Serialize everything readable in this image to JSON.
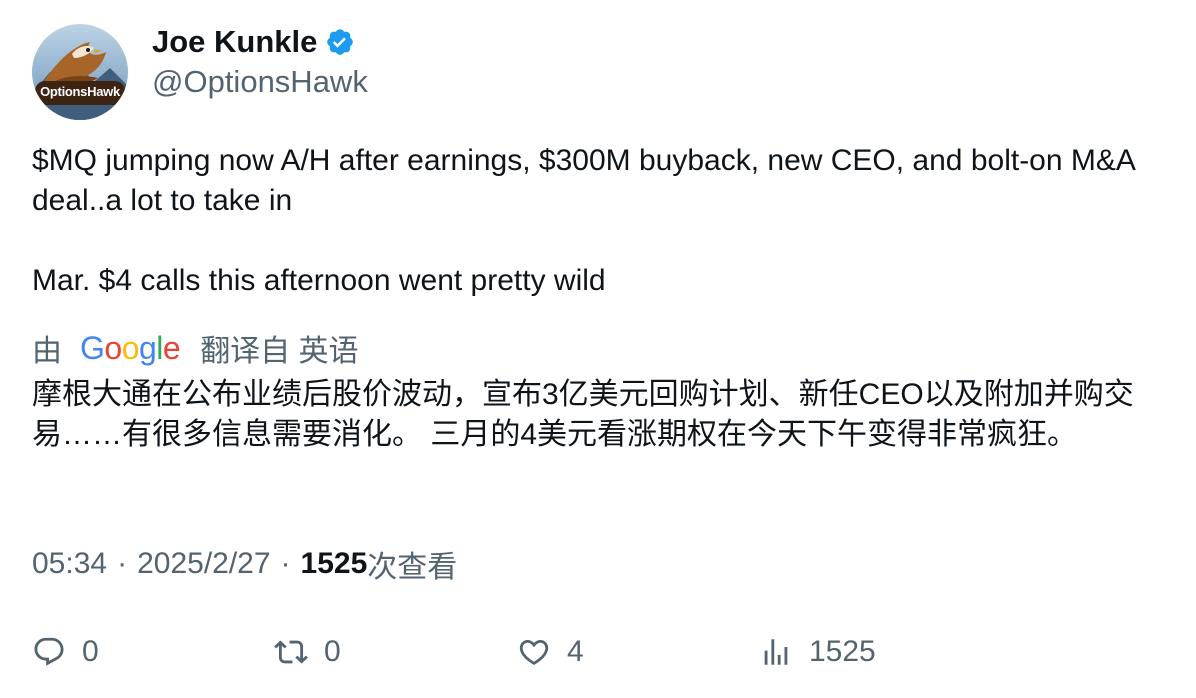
{
  "author": {
    "display_name": "Joe Kunkle",
    "handle": "@OptionsHawk",
    "verified": true,
    "avatar_text": "OptionsHawk"
  },
  "tweet": {
    "paragraphs": [
      "$MQ jumping now A/H after earnings, $300M buyback, new CEO, and bolt-on M&A deal..a lot to take in",
      "Mar. $4 calls this afternoon went pretty wild"
    ]
  },
  "translation": {
    "prefix": "由",
    "provider": "Google",
    "suffix": "翻译自 英语",
    "text": "摩根大通在公布业绩后股价波动，宣布3亿美元回购计划、新任CEO以及附加并购交易……有很多信息需要消化。 三月的4美元看涨期权在今天下午变得非常疯狂。"
  },
  "meta": {
    "time": "05:34",
    "separator": "·",
    "date": "2025/2/27",
    "views_count": "1525",
    "views_label": "次查看"
  },
  "actions": {
    "reply": {
      "icon": "reply-icon",
      "count": "0"
    },
    "retweet": {
      "icon": "retweet-icon",
      "count": "0"
    },
    "like": {
      "icon": "like-icon",
      "count": "4"
    },
    "views": {
      "icon": "views-icon",
      "count": "1525"
    }
  },
  "colors": {
    "text_primary": "#0f1419",
    "text_secondary": "#536471",
    "verified_blue": "#1d9bf0",
    "google_blue": "#4285F4",
    "google_red": "#EA4335",
    "google_yellow": "#FBBC05",
    "google_green": "#34A853"
  }
}
